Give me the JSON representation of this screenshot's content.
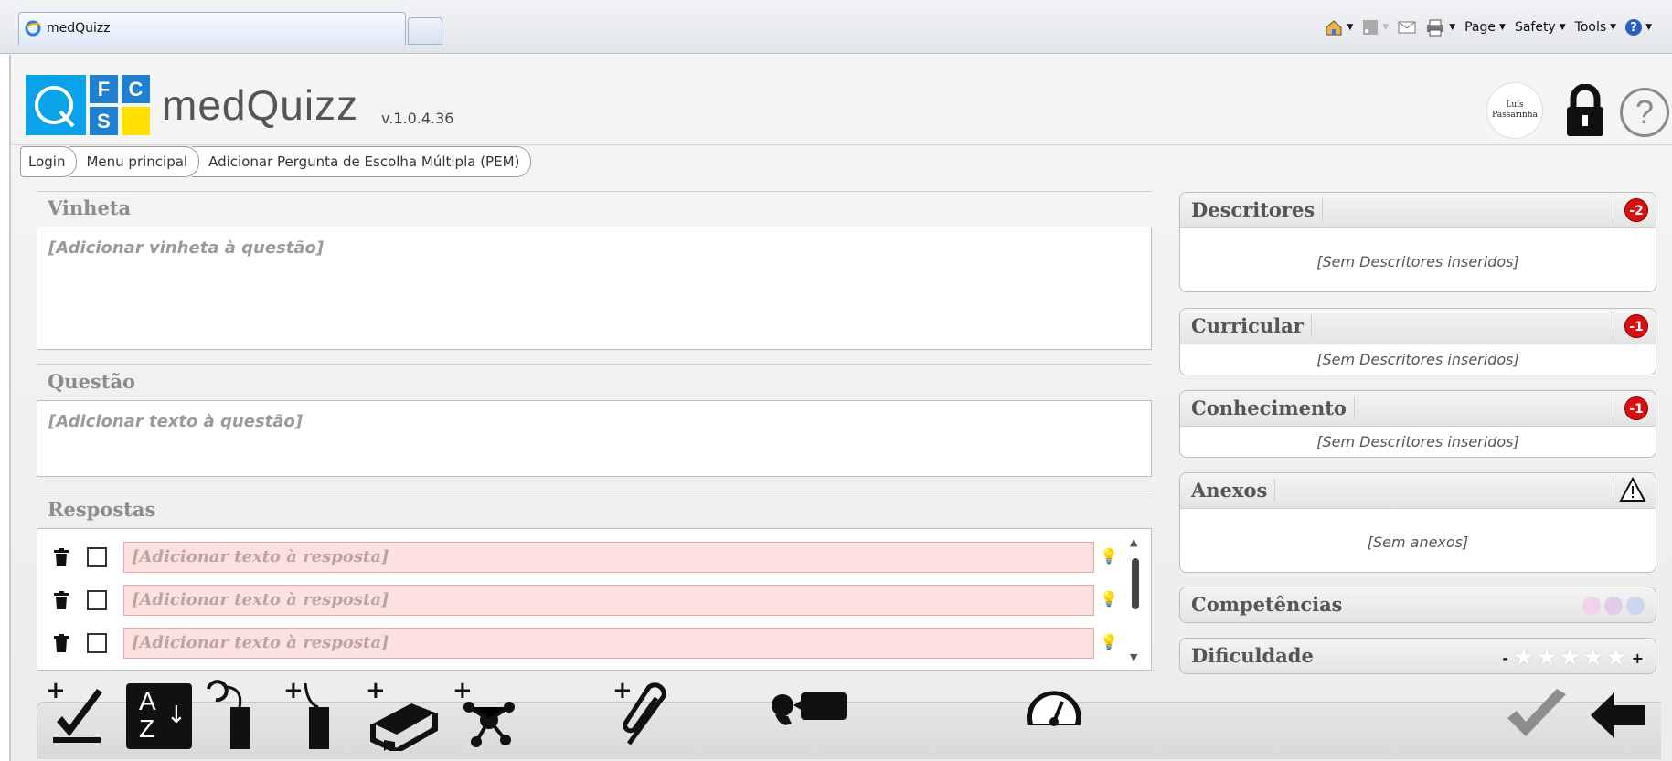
{
  "browser": {
    "tab_title": "medQuizz",
    "commands": {
      "page": "Page",
      "safety": "Safety",
      "tools": "Tools"
    }
  },
  "app": {
    "logo_letters": [
      "F",
      "C",
      "S"
    ],
    "title": "medQuizz",
    "version": "v.1.0.4.36",
    "user_name_line1": "Luís",
    "user_name_line2": "Passarinha"
  },
  "breadcrumb": [
    "Login",
    "Menu principal",
    "Adicionar Pergunta de Escolha Múltipla (PEM)"
  ],
  "vinheta": {
    "title": "Vinheta",
    "placeholder": "[Adicionar vinheta à questão]"
  },
  "questao": {
    "title": "Questão",
    "placeholder": "[Adicionar texto à questão]"
  },
  "respostas": {
    "title": "Respostas",
    "answers": [
      {
        "placeholder": "[Adicionar texto à resposta]"
      },
      {
        "placeholder": "[Adicionar texto à resposta]"
      },
      {
        "placeholder": "[Adicionar texto à resposta]"
      }
    ]
  },
  "panels": {
    "descritores": {
      "title": "Descritores",
      "badge": "-2",
      "empty": "[Sem Descritores inseridos]"
    },
    "curricular": {
      "title": "Curricular",
      "badge": "-1",
      "empty": "[Sem Descritores inseridos]"
    },
    "conhecimento": {
      "title": "Conhecimento",
      "badge": "-1",
      "empty": "[Sem Descritores inseridos]"
    },
    "anexos": {
      "title": "Anexos",
      "empty": "[Sem anexos]"
    },
    "competencias": {
      "title": "Competências",
      "dot_colors": [
        "#f0d3ea",
        "#e0cbe9",
        "#ccd6ee"
      ]
    },
    "dificuldade": {
      "title": "Dificuldade",
      "minus": "-",
      "plus": "+",
      "stars_filled": 0,
      "stars_total": 5
    }
  },
  "colors": {
    "accent_blue": "#0aa3ea",
    "logo_blue": "#1f7fd0",
    "logo_yellow": "#ffe000",
    "badge_red": "#d81010",
    "answer_bg": "#fde0e0"
  },
  "toolbar": {
    "az_label_top": "A",
    "az_label_bottom": "Z"
  }
}
